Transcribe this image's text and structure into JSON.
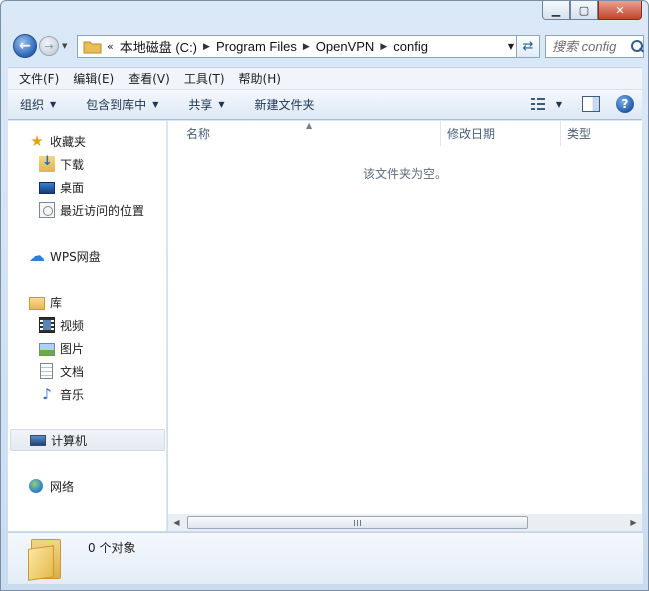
{
  "window": {
    "caption_buttons": [
      "minimize",
      "maximize",
      "close"
    ]
  },
  "address": {
    "chevrons": "«",
    "crumbs": [
      "本地磁盘 (C:)",
      "Program Files",
      "OpenVPN",
      "config"
    ]
  },
  "search": {
    "placeholder": "搜索 config"
  },
  "menu": {
    "items": [
      "文件(F)",
      "编辑(E)",
      "查看(V)",
      "工具(T)",
      "帮助(H)"
    ]
  },
  "commands": {
    "organize": "组织",
    "include_library": "包含到库中",
    "share": "共享",
    "new_folder": "新建文件夹"
  },
  "nav": {
    "favorites": "收藏夹",
    "downloads": "下载",
    "desktop": "桌面",
    "recent": "最近访问的位置",
    "wps": "WPS网盘",
    "libraries": "库",
    "videos": "视频",
    "pictures": "图片",
    "documents": "文档",
    "music": "音乐",
    "computer": "计算机",
    "network": "网络"
  },
  "columns": {
    "name": "名称",
    "date": "修改日期",
    "type": "类型"
  },
  "content": {
    "empty_message": "该文件夹为空。"
  },
  "details": {
    "count_text": "0 个对象"
  },
  "icons": {
    "back": "back-arrow-icon",
    "forward": "forward-arrow-icon",
    "refresh": "refresh-icon",
    "search": "search-icon",
    "views": "views-icon",
    "preview_pane": "preview-pane-icon",
    "help": "help-icon"
  },
  "colors": {
    "chrome": "#dbe9f7",
    "close_button": "#c2442b",
    "accent": "#2a63b5"
  }
}
